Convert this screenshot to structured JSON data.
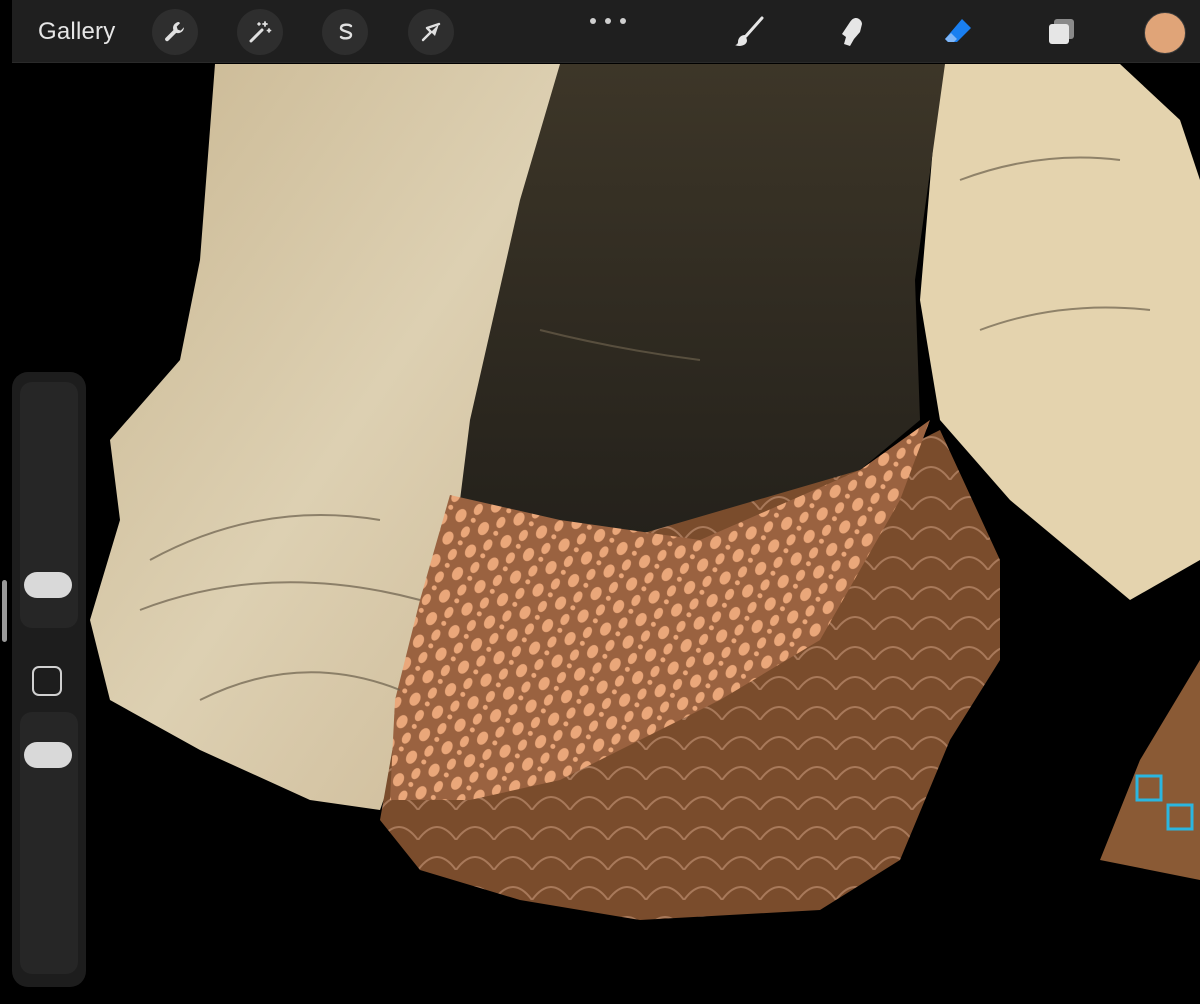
{
  "app": {
    "gallery_label": "Gallery"
  },
  "toolbar": {
    "left_tools": [
      {
        "name": "actions",
        "icon": "wrench-icon"
      },
      {
        "name": "adjustments",
        "icon": "magic-wand-icon"
      },
      {
        "name": "selection",
        "icon": "selection-s-icon"
      },
      {
        "name": "transform",
        "icon": "arrow-cursor-icon"
      }
    ],
    "more_icon": "ellipsis-icon",
    "right_tools": [
      {
        "name": "brush",
        "icon": "brush-icon",
        "active": false
      },
      {
        "name": "smudge",
        "icon": "smudge-finger-icon",
        "active": false
      },
      {
        "name": "eraser",
        "icon": "eraser-icon",
        "active": true
      },
      {
        "name": "layers",
        "icon": "layers-icon",
        "active": false
      }
    ],
    "current_color": "#E0A478"
  },
  "sidebar": {
    "brush_size_icon": "brush-size-slider",
    "modify_icon": "square-modify-icon",
    "opacity_icon": "brush-opacity-slider"
  },
  "colors": {
    "toolbar_bg": "#1f1f1f",
    "active_tool": "#1a7ff0",
    "shirt": "#d9c8a6",
    "vest": "#2f2a20",
    "sash": "#8a5a35",
    "batik_pattern": "#eaa77a",
    "accent_cyan": "#2bb6e0"
  }
}
